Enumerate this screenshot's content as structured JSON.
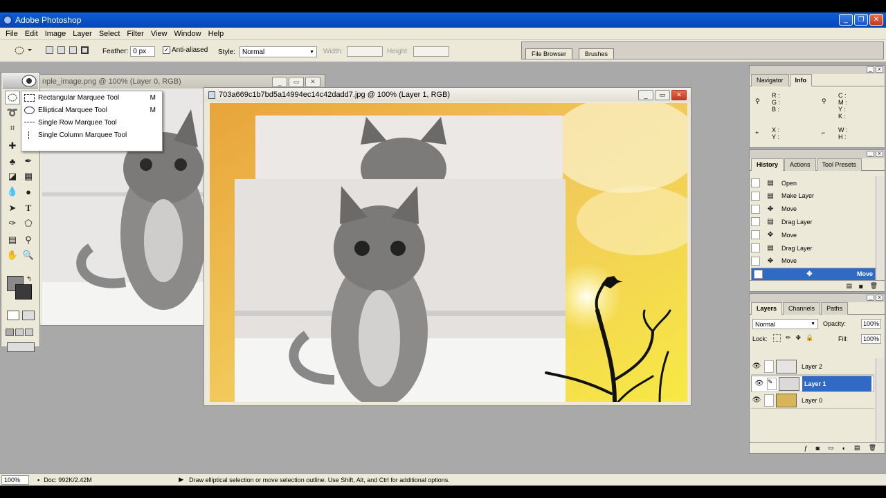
{
  "app": {
    "title": "Adobe Photoshop"
  },
  "menu": [
    "File",
    "Edit",
    "Image",
    "Layer",
    "Select",
    "Filter",
    "View",
    "Window",
    "Help"
  ],
  "options": {
    "feather_label": "Feather:",
    "feather_value": "0 px",
    "antialiased_label": "Anti-aliased",
    "antialiased_checked": true,
    "style_label": "Style:",
    "style_value": "Normal",
    "width_label": "Width:",
    "height_label": "Height:"
  },
  "palette_well": {
    "tabs": [
      "File Browser",
      "Brushes"
    ]
  },
  "doc1": {
    "title": "nple_image.png @ 100% (Layer 0, RGB)"
  },
  "doc2": {
    "title": "703a669c1b7bd5a14994ec14c42dadd7.jpg @ 100% (Layer 1, RGB)"
  },
  "flyout": {
    "items": [
      {
        "label": "Rectangular Marquee Tool",
        "key": "M",
        "icon": "rect-marquee-icon"
      },
      {
        "label": "Elliptical Marquee Tool",
        "key": "M",
        "icon": "ellipse-marquee-icon"
      },
      {
        "label": "Single Row Marquee Tool",
        "key": "",
        "icon": "row-marquee-icon"
      },
      {
        "label": "Single Column Marquee Tool",
        "key": "",
        "icon": "column-marquee-icon"
      }
    ]
  },
  "info": {
    "tabs": [
      "Navigator",
      "Info"
    ],
    "rgb_labels": "R :\nG :\nB :",
    "cmyk_labels": "C :\nM :\nY :\nK :",
    "xy_labels": "X :\nY :",
    "wh_labels": "W :\nH :"
  },
  "history": {
    "tabs": [
      "History",
      "Actions",
      "Tool Presets"
    ],
    "items": [
      {
        "label": "Open",
        "icon": "document-icon"
      },
      {
        "label": "Make Layer",
        "icon": "document-icon"
      },
      {
        "label": "Move",
        "icon": "move-icon"
      },
      {
        "label": "Drag Layer",
        "icon": "document-icon"
      },
      {
        "label": "Move",
        "icon": "move-icon"
      },
      {
        "label": "Drag Layer",
        "icon": "document-icon"
      },
      {
        "label": "Move",
        "icon": "move-icon"
      },
      {
        "label": "Move",
        "icon": "move-icon",
        "selected": true
      }
    ]
  },
  "layers": {
    "tabs": [
      "Layers",
      "Channels",
      "Paths"
    ],
    "blend_mode": "Normal",
    "opacity_label": "Opacity:",
    "opacity_value": "100%",
    "lock_label": "Lock:",
    "fill_label": "Fill:",
    "fill_value": "100%",
    "items": [
      {
        "name": "Layer 2",
        "selected": false,
        "thumb": "#e6e4e2"
      },
      {
        "name": "Layer 1",
        "selected": true,
        "thumb": "#dcdad8"
      },
      {
        "name": "Layer 0",
        "selected": false,
        "thumb": "#d9b55a"
      }
    ]
  },
  "status": {
    "zoom": "100%",
    "doc": "Doc: 992K/2.42M",
    "hint": "Draw elliptical selection or move selection outline.  Use Shift, Alt, and Ctrl for additional options."
  },
  "colors": {
    "accent": "#316ac5",
    "title_bar": "#0a5fd8",
    "workspace": "#a9a9a9"
  }
}
